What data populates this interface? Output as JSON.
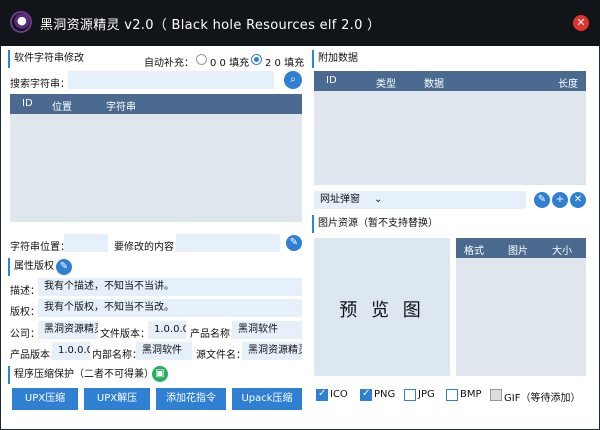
{
  "window": {
    "title": "黑洞资源精灵 v2.0（ Black hole Resources elf 2.0 ）",
    "close_glyph": "✕"
  },
  "left": {
    "string_section": {
      "title": "软件字符串修改",
      "autofill_label": "自动补充：",
      "radio_00": "0 0 填充",
      "radio_20": "2 0 填充",
      "radio_selected": "20",
      "search_label": "搜索字符串：",
      "search_value": "",
      "search_icon": "search-icon",
      "columns": [
        "ID",
        "位置",
        "字符串"
      ],
      "pos_label": "字符串位置：",
      "pos_value": "",
      "change_label": "要修改的内容：",
      "change_value": ""
    },
    "props_section": {
      "title": "属性版权",
      "desc_label": "描述：",
      "desc_value": "我有个描述，不知当不当讲。",
      "copyright_label": "版权：",
      "copyright_value": "我有个版权，不知当不当改。",
      "company_label": "公司：",
      "company_value": "黑洞资源精灵",
      "filever_label": "文件版本：",
      "filever_value": "1.0.0.0",
      "product_label": "产品名称：",
      "product_value": "黑洞软件",
      "prodver_label": "产品版本：",
      "prodver_value": "1.0.0.0",
      "internal_label": "内部名称：",
      "internal_value": "黑洞软件",
      "origfile_label": "源文件名：",
      "origfile_value": "黑洞资源精灵"
    },
    "protect_section": {
      "title": "程序压缩保护（二者不可得兼）",
      "buttons": [
        "UPX压缩",
        "UPX解压",
        "添加花指令",
        "Upack压缩"
      ]
    }
  },
  "right": {
    "extra_section": {
      "title": "附加数据",
      "columns": [
        "ID",
        "类型",
        "数据",
        "长度"
      ],
      "dropdown_value": "网址弹窗"
    },
    "image_section": {
      "title": "图片资源（暂不支持替换）",
      "preview_text": "预 览 图",
      "columns": [
        "格式",
        "图片",
        "大小"
      ],
      "formats": [
        {
          "label": "ICO",
          "checked": true
        },
        {
          "label": "PNG",
          "checked": true
        },
        {
          "label": "JPG",
          "checked": false
        },
        {
          "label": "BMP",
          "checked": false
        },
        {
          "label": "GIF（等待添加）",
          "checked": false
        }
      ]
    }
  },
  "colors": {
    "accent": "#2f7fd3",
    "header": "#4a6b8f",
    "titlebar": "#111418",
    "field": "#e6f0fb",
    "close": "#e0322d"
  }
}
